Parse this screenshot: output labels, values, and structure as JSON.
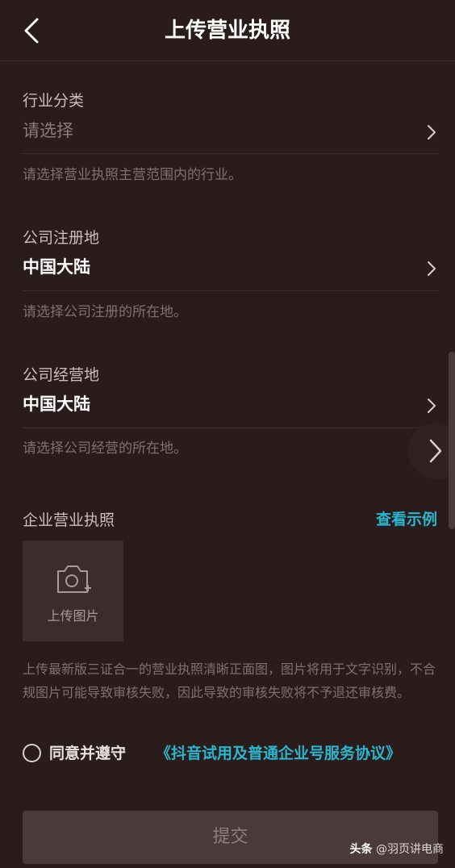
{
  "header": {
    "title": "上传营业执照"
  },
  "industry": {
    "label": "行业分类",
    "value": "请选择",
    "hint": "请选择营业执照主营范围内的行业。"
  },
  "registered": {
    "label": "公司注册地",
    "value": "中国大陆",
    "hint": "请选择公司注册的所在地。"
  },
  "operating": {
    "label": "公司经营地",
    "value": "中国大陆",
    "hint": "请选择公司经营的所在地。"
  },
  "license": {
    "label": "企业营业执照",
    "example_link": "查看示例",
    "upload_label": "上传图片",
    "description": "上传最新版三证合一的营业执照清晰正面图，图片将用于文字识别，不合规图片可能导致审核失败，因此导致的审核失败将不予退还审核费。"
  },
  "agreement": {
    "prefix": "同意并遵守",
    "link": "《抖音试用及普通企业号服务协议》"
  },
  "submit": {
    "label": "提交"
  },
  "watermark": {
    "brand": "头条",
    "handle": "@羽页讲电商"
  },
  "colors": {
    "background": "#2a1c1b",
    "accent": "#2ab6ce"
  }
}
